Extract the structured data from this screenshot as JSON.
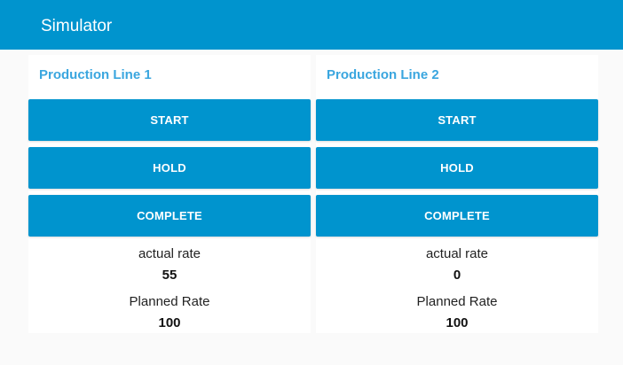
{
  "app": {
    "title": "Simulator"
  },
  "colors": {
    "primary": "#0094ce",
    "panel_title": "#3aa6df",
    "background": "#fafafa"
  },
  "lines": [
    {
      "title": "Production Line 1",
      "buttons": {
        "start": "START",
        "hold": "HOLD",
        "complete": "COMPLETE"
      },
      "actual_rate_label": "actual rate",
      "actual_rate": "55",
      "planned_rate_label": "Planned Rate",
      "planned_rate": "100"
    },
    {
      "title": "Production Line 2",
      "buttons": {
        "start": "START",
        "hold": "HOLD",
        "complete": "COMPLETE"
      },
      "actual_rate_label": "actual rate",
      "actual_rate": "0",
      "planned_rate_label": "Planned Rate",
      "planned_rate": "100"
    }
  ]
}
